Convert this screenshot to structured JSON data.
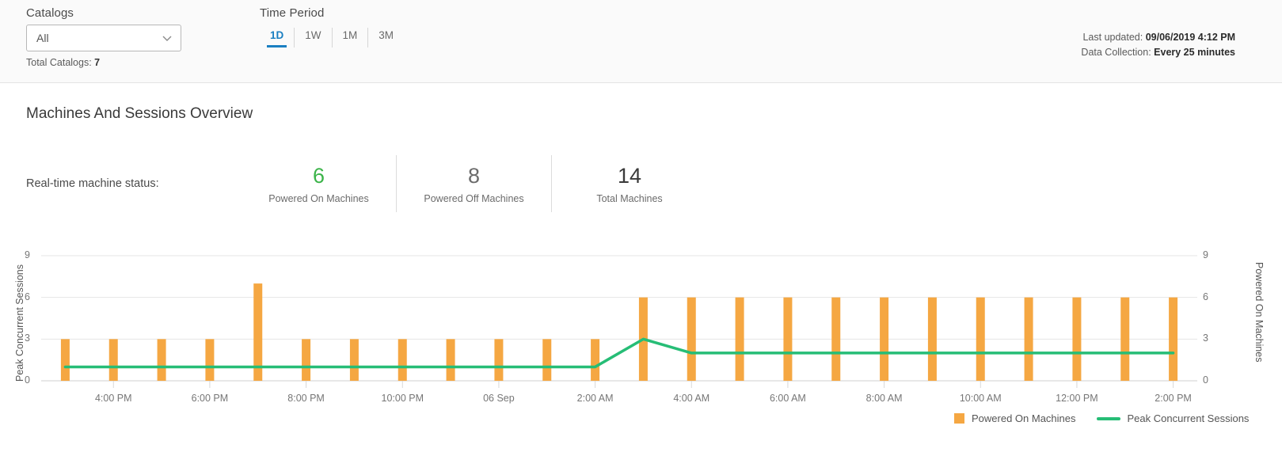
{
  "filters": {
    "catalogs_label": "Catalogs",
    "catalogs_value": "All",
    "catalogs_chevron": "chevron-down-icon",
    "total_catalogs_prefix": "Total Catalogs:",
    "total_catalogs_value": "7",
    "time_period_label": "Time Period",
    "time_tabs": [
      {
        "label": "1D",
        "active": true
      },
      {
        "label": "1W",
        "active": false
      },
      {
        "label": "1M",
        "active": false
      },
      {
        "label": "3M",
        "active": false
      }
    ]
  },
  "status_bar": {
    "last_updated_prefix": "Last updated:",
    "last_updated_value": "09/06/2019 4:12 PM",
    "data_collection_prefix": "Data Collection:",
    "data_collection_value": "Every 25 minutes"
  },
  "section": {
    "title": "Machines And Sessions Overview",
    "realtime_label": "Real-time machine status:",
    "stats": [
      {
        "value": "6",
        "caption": "Powered On Machines",
        "color": "#3cb44a"
      },
      {
        "value": "8",
        "caption": "Powered Off Machines",
        "color": "#6b6b6b"
      },
      {
        "value": "14",
        "caption": "Total Machines",
        "color": "#3a3a3a"
      }
    ]
  },
  "colors": {
    "bar": "#f5a742",
    "line": "#26bd76",
    "accent": "#1a7fc1",
    "grid": "#e6e6e6"
  },
  "chart_data": {
    "type": "bar",
    "title": "",
    "xlabel": "",
    "ylabel": "Peak Concurrent Sessions",
    "y2label": "Powered On Machines",
    "ylim": [
      0,
      9
    ],
    "y2lim": [
      0,
      9
    ],
    "yticks": [
      0,
      3,
      6,
      9
    ],
    "y2ticks": [
      0,
      3,
      6,
      9
    ],
    "grid": true,
    "legend_position": "bottom-right",
    "xtick_labels": [
      "4:00 PM",
      "6:00 PM",
      "8:00 PM",
      "10:00 PM",
      "06 Sep",
      "2:00 AM",
      "4:00 AM",
      "6:00 AM",
      "8:00 AM",
      "10:00 AM",
      "12:00 PM",
      "2:00 PM"
    ],
    "xtick_index": [
      1,
      3,
      5,
      7,
      9,
      11,
      13,
      15,
      17,
      19,
      21,
      23
    ],
    "series": [
      {
        "name": "Powered On Machines",
        "type": "bar",
        "color": "#f5a742",
        "axis": "right",
        "values": [
          3,
          3,
          3,
          3,
          7,
          3,
          3,
          3,
          3,
          3,
          3,
          3,
          6,
          6,
          6,
          6,
          6,
          6,
          6,
          6,
          6,
          6,
          6,
          6
        ]
      },
      {
        "name": "Peak Concurrent Sessions",
        "type": "line",
        "color": "#26bd76",
        "axis": "left",
        "values": [
          1,
          1,
          1,
          1,
          1,
          1,
          1,
          1,
          1,
          1,
          1,
          1,
          3,
          2,
          2,
          2,
          2,
          2,
          2,
          2,
          2,
          2,
          2,
          2
        ]
      }
    ]
  },
  "legend": {
    "items": [
      {
        "label": "Powered On Machines",
        "marker": "square-swatch-icon"
      },
      {
        "label": "Peak Concurrent Sessions",
        "marker": "line-swatch-icon"
      }
    ]
  }
}
